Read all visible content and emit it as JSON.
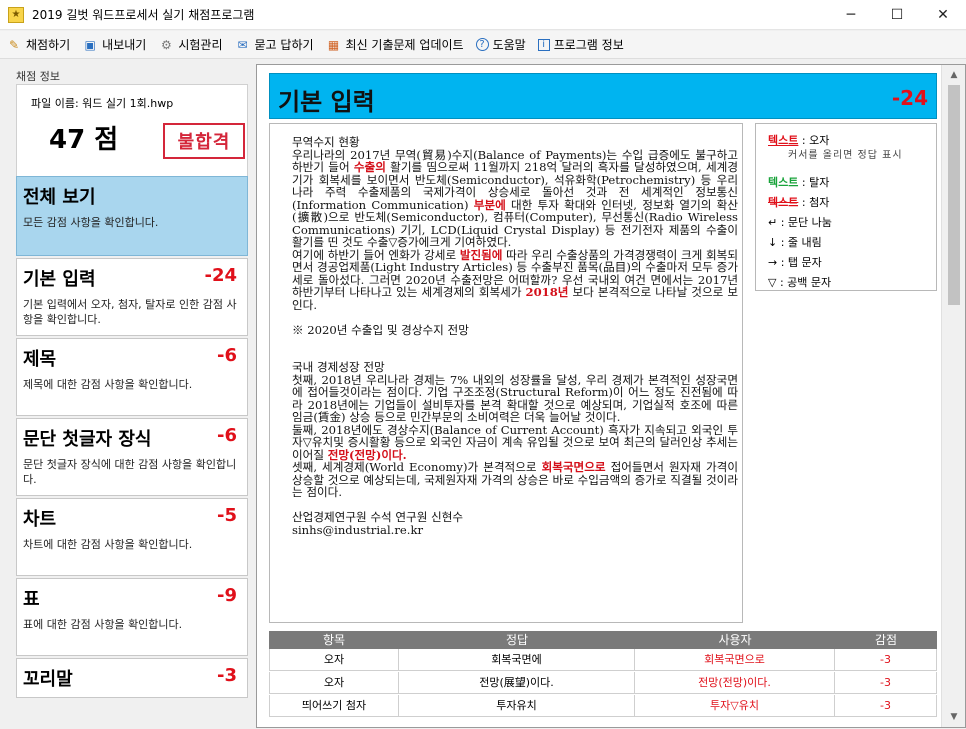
{
  "window": {
    "title": "2019 길벗 워드프로세서 실기 채점프로그램",
    "minimize": "─",
    "maximize": "☐",
    "close": "✕"
  },
  "toolbar": {
    "items": [
      {
        "label": "채점하기",
        "icon": "pencil-icon",
        "glyph": "✎"
      },
      {
        "label": "내보내기",
        "icon": "save-icon",
        "glyph": "▣"
      },
      {
        "label": "시험관리",
        "icon": "settings-icon",
        "glyph": "⚙"
      },
      {
        "label": "묻고 답하기",
        "icon": "qa-icon",
        "glyph": "✉"
      },
      {
        "label": "최신 기출문제 업데이트",
        "icon": "gift-icon",
        "glyph": "▦"
      },
      {
        "label": "도움말",
        "icon": "help-icon",
        "glyph": "?"
      },
      {
        "label": "프로그램 정보",
        "icon": "info-icon",
        "glyph": "i"
      }
    ]
  },
  "info": {
    "section_label": "채점 정보",
    "file_name": "파일 이름: 워드 실기 1회.hwp",
    "score": "47 점",
    "stamp": "불합격"
  },
  "categories": [
    {
      "title": "전체 보기",
      "score": "",
      "desc": "모든 감점 사항을 확인합니다."
    },
    {
      "title": "기본 입력",
      "score": "-24",
      "desc": "기본 입력에서 오자, 첨자, 탈자로 인한 감점 사항을 확인합니다."
    },
    {
      "title": "제목",
      "score": "-6",
      "desc": "제목에 대한 감점 사항을 확인합니다."
    },
    {
      "title": "문단 첫글자 장식",
      "score": "-6",
      "desc": "문단 첫글자 장식에 대한 감점 사항을 확인합니다."
    },
    {
      "title": "차트",
      "score": "-5",
      "desc": "차트에 대한 감점 사항을 확인합니다."
    },
    {
      "title": "표",
      "score": "-9",
      "desc": "표에 대한 감점 사항을 확인합니다."
    },
    {
      "title": "꼬리말",
      "score": "-3",
      "desc": ""
    }
  ],
  "detail": {
    "title": "기본 입력",
    "score": "-24"
  },
  "document": {
    "p1": "무역수지 현황",
    "p2a": "우리나라의 2017년 무역(貿易)수지(Balance of Payments)는 수입 급증에도 불구하고 하반기 들어 ",
    "p2r1": "수출의",
    "p2b": " 활기를 띰으로써 11월까지 218억 달러의 흑자를 달성하였으며, 세계경기가 회복세를 보이면서 반도체(Semiconductor), 석유화학(Petrochemistry) 등 우리나라 주력 수출제품의 국제가격이 상승세로 돌아선 것과 전 세계적인 정보통신(Information Communication) ",
    "p2r2": "부분에",
    "p2c": " 대한 투자 확대와 인터넷, 정보화 열기의 확산(擴散)으로 반도체(Semiconductor), 컴퓨터(Computer), 무선통신(Radio Wireless Communications) 기기, LCD(Liquid Crystal Display) 등 전기전자 제품의 수출이 활기를 띤 것도 수출▽증가에크게 기여하였다.",
    "p3a": "여기에 하반기 들어 엔화가 강세로 ",
    "p3r1": "발진됨에",
    "p3b": " 따라 우리 수출상품의 가격경쟁력이 크게 회복되면서 경공업제품(Light Industry Articles) 등 수출부진 품목(品目)의 수출마저 모두 증가세로 돌아섰다. 그러면 2020년 수출전망은 어떠할까? 우선 국내외 여건 면에서는 2017년 하반기부터 나타나고 있는 세계경제의 회복세가 ",
    "p3r2": "2018년",
    "p3c": " 보다 본격적으로 나타날 것으로 보인다.",
    "p4": "※ 2020년 수출입 및 경상수지 전망",
    "p5": "국내 경제성장 전망",
    "p6": "첫째, 2018년 우리나라 경제는 7% 내외의 성장률을 달성, 우리 경제가 본격적인 성장국면에 접어들것이라는 점이다. 기업 구조조정(Structural Reform)이 어느 정도 진전됨에 따라 2018년에는 기업들이 설비투자를 본격 확대할 것으로 예상되며, 기업실적 호조에 따른 임금(賃金) 상승 등으로 민간부문의 소비여력은 더욱 늘어날 것이다.",
    "p7a": "둘째, 2018년에도 경상수지(Balance of Current Account) 흑자가 지속되고 외국인 투자▽유치및 증시활황 등으로 외국인 자금이 계속 유입될 것으로 보여 최근의 달러인상 추세는 이어질 ",
    "p7r1": "전망(전망)이다.",
    "p8a": "셋째, 세계경제(World Economy)가 본격적으로 ",
    "p8r1": "회복국면으로",
    "p8b": " 접어들면서 원자재 가격이 상승할 것으로 예상되는데, 국제원자재 가격의 상승은 바로 수입금액의 증가로 직결될 것이라는 점이다.",
    "p9": "산업경제연구원 수석 연구원 신현수",
    "p10": "sinhs@industrial.re.kr"
  },
  "legend": {
    "typo_mark": "텍스트",
    "typo": " : 오자",
    "typo_hint": "커서를 올리면 정답 표시",
    "missing_mark": "텍스트",
    "missing": " : 탈자",
    "extra_mark": "텍스트",
    "extra": " : 첨자",
    "para_break": "↵ : 문단 나눔",
    "line_break": "↓ : 줄 내림",
    "tab": "→ : 탭 문자",
    "space": "▽ : 공백 문자"
  },
  "table": {
    "headers": [
      "항목",
      "정답",
      "사용자",
      "감점"
    ],
    "rows": [
      [
        "오자",
        "회복국면에",
        "회복국면으로",
        "-3"
      ],
      [
        "오자",
        "전망(展望)이다.",
        "전망(전망)이다.",
        "-3"
      ],
      [
        "띄어쓰기 첨자",
        "투자유치",
        "투자▽유치",
        "-3"
      ]
    ]
  }
}
